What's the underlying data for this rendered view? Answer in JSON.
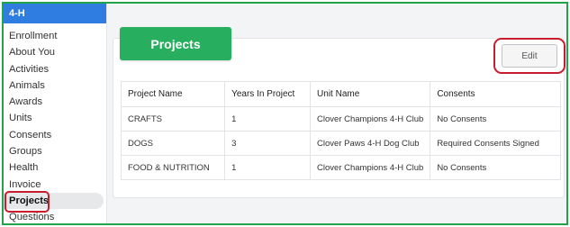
{
  "sidebar": {
    "header": "4-H",
    "items": [
      {
        "label": "Enrollment"
      },
      {
        "label": "About You"
      },
      {
        "label": "Activities"
      },
      {
        "label": "Animals"
      },
      {
        "label": "Awards"
      },
      {
        "label": "Units"
      },
      {
        "label": "Consents"
      },
      {
        "label": "Groups"
      },
      {
        "label": "Health"
      },
      {
        "label": "Invoice"
      },
      {
        "label": "Projects",
        "active": true
      },
      {
        "label": "Questions"
      }
    ]
  },
  "main": {
    "tab_title": "Projects",
    "edit_label": "Edit",
    "table": {
      "headers": [
        "Project Name",
        "Years In Project",
        "Unit Name",
        "Consents"
      ],
      "rows": [
        [
          "CRAFTS",
          "1",
          "Clover Champions 4-H Club",
          "No Consents"
        ],
        [
          "DOGS",
          "3",
          "Clover Paws 4-H Dog Club",
          "Required Consents Signed"
        ],
        [
          "FOOD & NUTRITION",
          "1",
          "Clover Champions 4-H Club",
          "No Consents"
        ]
      ]
    }
  },
  "colors": {
    "frame_border": "#22a34a",
    "sidebar_header": "#2f7de1",
    "projects_tab": "#27ae5e",
    "highlight": "#c81d2f"
  }
}
